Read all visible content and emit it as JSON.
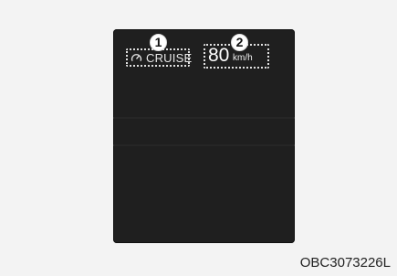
{
  "cluster": {
    "cruise_label": "CRUISE",
    "speed_value": "80",
    "speed_unit": "km/h",
    "cruise_icon": "cruise-control-icon"
  },
  "callouts": [
    "1",
    "2"
  ],
  "figure_code": "OBC3073226L"
}
